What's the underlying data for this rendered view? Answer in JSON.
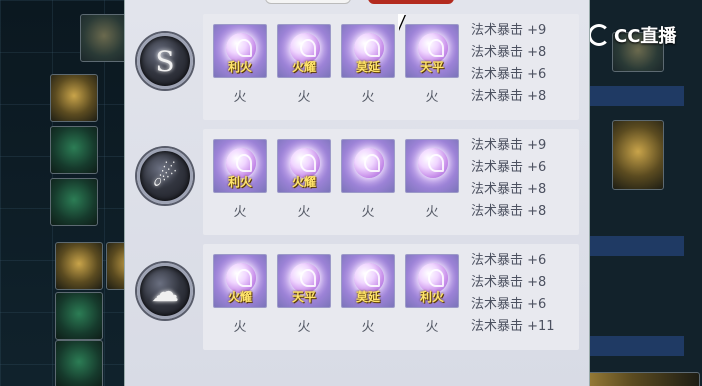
{
  "watermark": {
    "brand": "CC直播"
  },
  "groups": [
    {
      "emblem_glyph": "S",
      "gems": [
        {
          "name": "利火",
          "label": "火"
        },
        {
          "name": "火耀",
          "label": "火"
        },
        {
          "name": "莫延",
          "label": "火"
        },
        {
          "name": "天平",
          "label": "火"
        }
      ],
      "stats": [
        "法术暴击 +9",
        "法术暴击 +8",
        "法术暴击 +6",
        "法术暴击 +8"
      ]
    },
    {
      "emblem_glyph": "☄",
      "gems": [
        {
          "name": "利火",
          "label": "火"
        },
        {
          "name": "火耀",
          "label": "火"
        },
        {
          "name": "",
          "label": "火"
        },
        {
          "name": "",
          "label": "火"
        }
      ],
      "stats": [
        "法术暴击 +9",
        "法术暴击 +6",
        "法术暴击 +8",
        "法术暴击 +8"
      ]
    },
    {
      "emblem_glyph": "☁",
      "gems": [
        {
          "name": "火耀",
          "label": "火"
        },
        {
          "name": "天平",
          "label": "火"
        },
        {
          "name": "莫延",
          "label": "火"
        },
        {
          "name": "利火",
          "label": "火"
        }
      ],
      "stats": [
        "法术暴击 +6",
        "法术暴击 +8",
        "法术暴击 +6",
        "法术暴击 +11"
      ]
    }
  ]
}
